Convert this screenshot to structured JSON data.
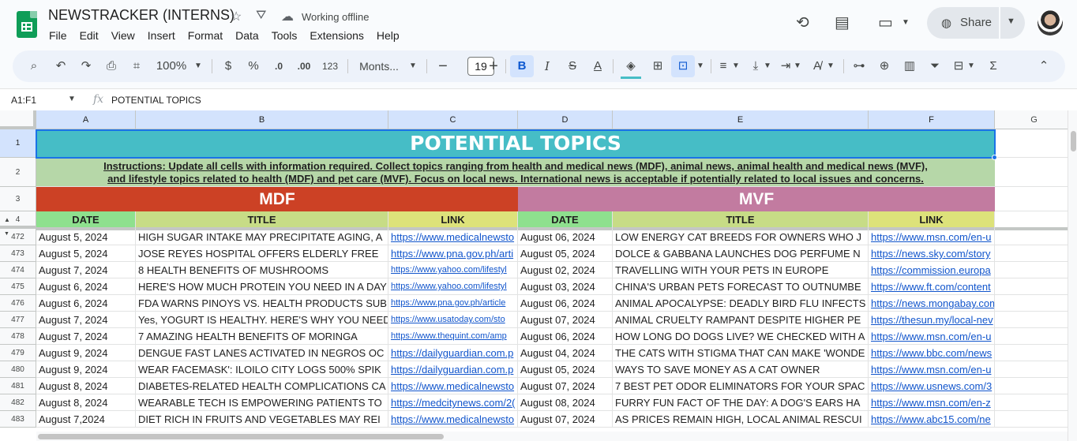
{
  "app": {
    "doc_title": "NEWSTRACKER (INTERNS)",
    "status": "Working offline",
    "menu": [
      "File",
      "Edit",
      "View",
      "Insert",
      "Format",
      "Data",
      "Tools",
      "Extensions",
      "Help"
    ],
    "share_label": "Share"
  },
  "toolbar": {
    "zoom": "100%",
    "currency": "$",
    "percent": "%",
    "dec_decrease": ".0",
    "dec_increase": ".00",
    "number_format": "123",
    "font": "Monts...",
    "font_size": "19"
  },
  "formula_bar": {
    "name_box": "A1:F1",
    "fx": "fx",
    "content": "POTENTIAL TOPICS"
  },
  "columns": [
    "A",
    "B",
    "C",
    "D",
    "E",
    "F",
    "G"
  ],
  "banner": {
    "title": "POTENTIAL TOPICS",
    "instructions_1": "Instructions: Update all cells with information required. Collect topics ranging from health and medical news (MDF), animal news, animal health and medical news (MVF),",
    "instructions_2": "and lifestyle topics related to health (MDF)  and pet care (MVF). Focus on local news. International news is acceptable if potentially related to local issues and concerns.",
    "mdf": "MDF",
    "mvf": "MVF"
  },
  "headers": {
    "date": "DATE",
    "title": "TITLE",
    "link": "LINK"
  },
  "row_numbers_top": [
    "1",
    "2",
    "3",
    "4"
  ],
  "rows": [
    {
      "n": "472",
      "a": "August 5, 2024",
      "b": "HIGH SUGAR INTAKE MAY PRECIPITATE AGING, A",
      "c": "https://www.medicalnewsto",
      "d": "August 06, 2024",
      "e": "LOW ENERGY CAT BREEDS FOR OWNERS WHO J",
      "f": "https://www.msn.com/en-u"
    },
    {
      "n": "473",
      "a": "August 5, 2024",
      "b": "JOSE REYES HOSPITAL OFFERS ELDERLY FREE",
      "c": "https://www.pna.gov.ph/arti",
      "d": "August 05, 2024",
      "e": "DOLCE & GABBANA LAUNCHES DOG PERFUME N",
      "f": "https://news.sky.com/story"
    },
    {
      "n": "474",
      "a": "August 7, 2024",
      "b": "8 HEALTH BENEFITS OF MUSHROOMS",
      "c": "https://www.yahoo.com/lifestyl",
      "d": "August 02, 2024",
      "e": "TRAVELLING WITH YOUR PETS IN EUROPE",
      "f": "https://commission.europa"
    },
    {
      "n": "475",
      "a": "August 6, 2024",
      "b": "HERE'S HOW MUCH PROTEIN YOU NEED IN A DAY — D",
      "c": "https://www.yahoo.com/lifestyl",
      "d": "August 03, 2024",
      "e": "CHINA'S URBAN PETS FORECAST TO OUTNUMBE",
      "f": "https://www.ft.com/content"
    },
    {
      "n": "476",
      "a": "August 6, 2024",
      "b": "FDA WARNS PINOYS VS. HEALTH PRODUCTS SUBMER",
      "c": "https://www.pna.gov.ph/article",
      "d": "August 06, 2024",
      "e": "ANIMAL APOCALYPSE: DEADLY BIRD FLU INFECTS",
      "f": "https://news.mongabay.com"
    },
    {
      "n": "477",
      "a": "August 7, 2024",
      "b": "Yes, YOGURT IS HEALTHY. HERE'S WHY YOU NEED TO",
      "c": "https://www.usatoday.com/sto",
      "d": "August 07, 2024",
      "e": "ANIMAL CRUELTY RAMPANT DESPITE HIGHER PE",
      "f": "https://thesun.my/local-nev"
    },
    {
      "n": "478",
      "a": "August 7, 2024",
      "b": "7 AMAZING HEALTH BENEFITS OF MORINGA",
      "c": "https://www.thequint.com/amp",
      "d": "August 06, 2024",
      "e": "HOW LONG DO DOGS LIVE? WE CHECKED WITH A",
      "f": "https://www.msn.com/en-u"
    },
    {
      "n": "479",
      "a": "August 9, 2024",
      "b": "DENGUE FAST LANES ACTIVATED IN NEGROS OC",
      "c": "https://dailyguardian.com.p",
      "d": "August 04, 2024",
      "e": "THE CATS WITH STIGMA THAT CAN MAKE 'WONDE",
      "f": "https://www.bbc.com/news"
    },
    {
      "n": "480",
      "a": "August 9, 2024",
      "b": "WEAR FACEMASK': ILOILO CITY LOGS 500% SPIK",
      "c": "https://dailyguardian.com.p",
      "d": "August 05, 2024",
      "e": "WAYS TO SAVE MONEY AS A CAT OWNER",
      "f": "https://www.msn.com/en-u"
    },
    {
      "n": "481",
      "a": "August 8, 2024",
      "b": "DIABETES-RELATED HEALTH COMPLICATIONS CA",
      "c": "https://www.medicalnewsto",
      "d": "August 07, 2024",
      "e": "7 BEST PET ODOR ELIMINATORS FOR YOUR SPAC",
      "f": "https://www.usnews.com/3"
    },
    {
      "n": "482",
      "a": "August 8, 2024",
      "b": "WEARABLE TECH IS EMPOWERING PATIENTS TO",
      "c": "https://medcitynews.com/2(",
      "d": "August 08, 2024",
      "e": "FURRY FUN FACT OF THE DAY: A DOG'S EARS HA",
      "f": "https://www.msn.com/en-z"
    },
    {
      "n": "483",
      "a": "August 7,2024",
      "b": "DIET RICH IN FRUITS AND VEGETABLES MAY REI",
      "c": "https://www.medicalnewsto",
      "d": "August 07, 2024",
      "e": "AS PRICES REMAIN HIGH, LOCAL ANIMAL RESCUI",
      "f": "https://www.abc15.com/ne"
    }
  ],
  "colors": {
    "title_bg": "#46bdc6",
    "instructions_bg": "#b6d7a8",
    "mdf_bg": "#cc4125",
    "mvf_bg": "#c27ba0",
    "date_header_bg": "#8ee08e",
    "title_header_bg": "#c7dc86",
    "link_header_bg": "#dde27a",
    "link_color": "#1155cc"
  }
}
